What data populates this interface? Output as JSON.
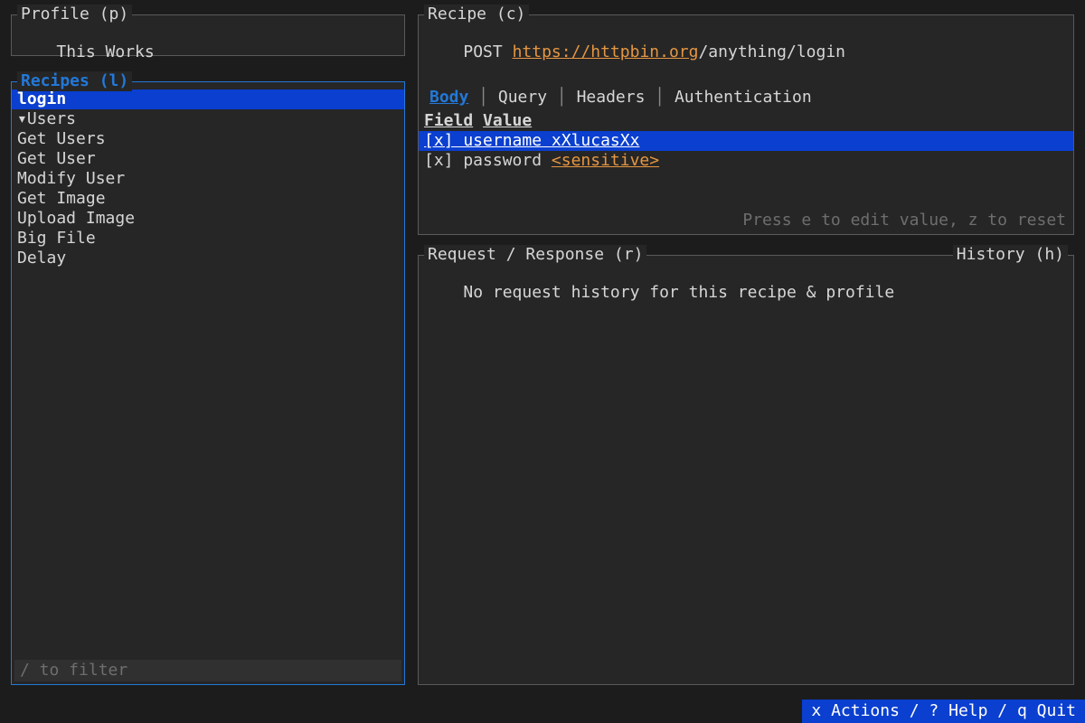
{
  "profile": {
    "title": "Profile (p)",
    "value": "This Works"
  },
  "recipes": {
    "title": "Recipes (l)",
    "filter_placeholder": "/ to filter",
    "items": [
      {
        "label": "login",
        "indent": 0,
        "selected": true,
        "collapsed": false,
        "collapsible": false
      },
      {
        "label": "Users",
        "indent": 0,
        "collapsible": true,
        "expanded": true
      },
      {
        "label": "Get Users",
        "indent": 1
      },
      {
        "label": "Get User",
        "indent": 1
      },
      {
        "label": "Modify User",
        "indent": 1
      },
      {
        "label": "Get Image",
        "indent": 0
      },
      {
        "label": "Upload Image",
        "indent": 0
      },
      {
        "label": "Big File",
        "indent": 0
      },
      {
        "label": "Delay",
        "indent": 0
      }
    ]
  },
  "recipe": {
    "title": "Recipe (c)",
    "method": "POST",
    "url_link": "https://httpbin.org",
    "url_rest": "/anything/login",
    "tabs": [
      "Body",
      "Query",
      "Headers",
      "Authentication"
    ],
    "active_tab": 0,
    "columns": {
      "field": "Field",
      "value": "Value"
    },
    "rows": [
      {
        "enabled": true,
        "field": "username",
        "value": "xXlucasXx",
        "sensitive": false,
        "selected": true
      },
      {
        "enabled": true,
        "field": "password",
        "value": "<sensitive>",
        "sensitive": true,
        "selected": false
      }
    ],
    "hint": "Press e to edit value, z to reset"
  },
  "reqres": {
    "title": "Request / Response (r)",
    "history_title": "History (h)",
    "empty": "No request history for this recipe & profile"
  },
  "footer": {
    "text": "x Actions / ? Help / q Quit"
  }
}
